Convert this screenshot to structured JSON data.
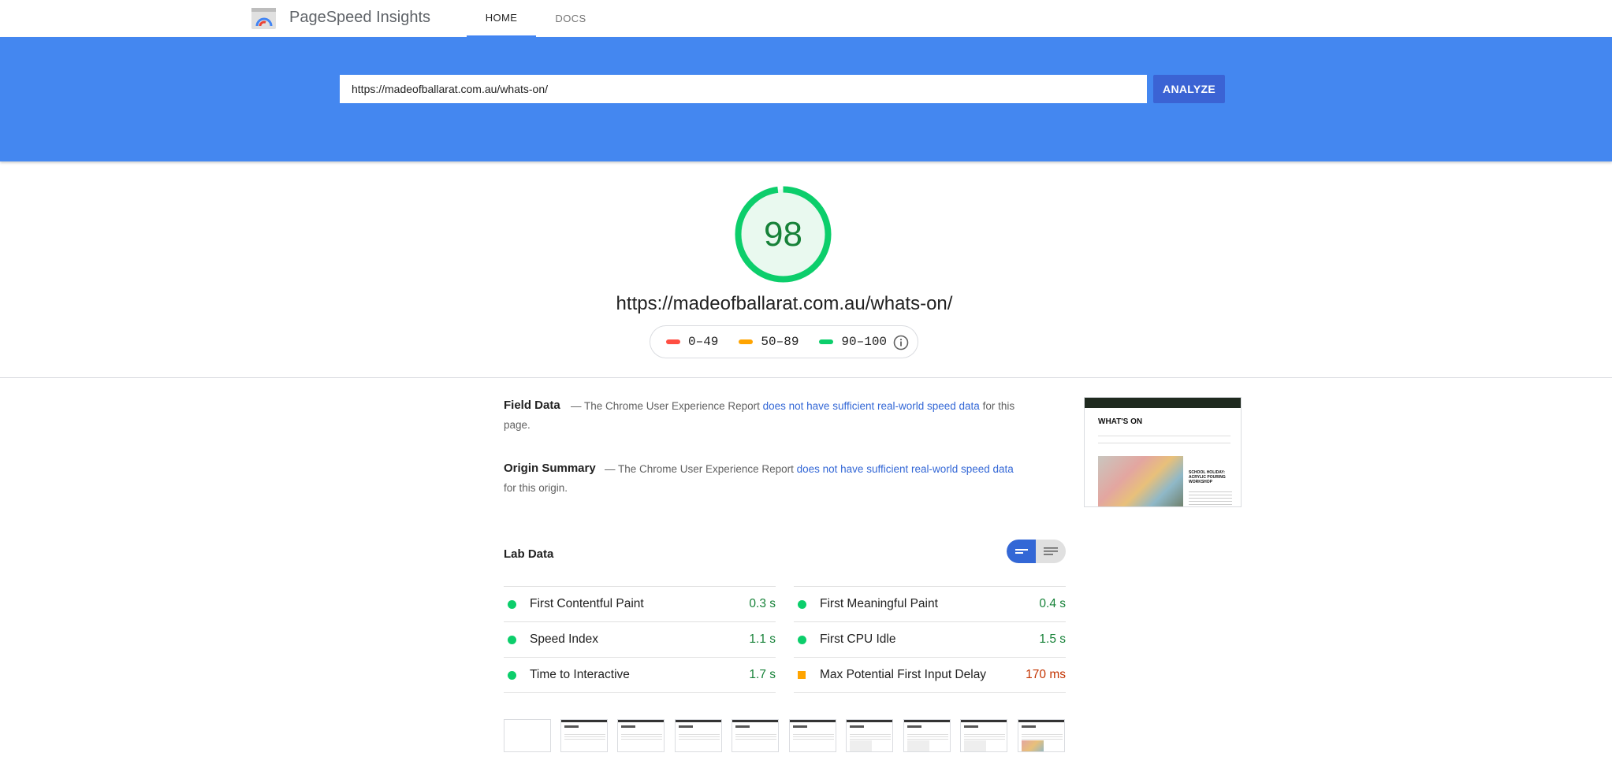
{
  "nav": {
    "brand": "PageSpeed Insights",
    "tabs": [
      {
        "label": "HOME",
        "active": true
      },
      {
        "label": "DOCS",
        "active": false
      }
    ]
  },
  "search": {
    "url_value": "https://madeofballarat.com.au/whats-on/",
    "analyze_label": "ANALYZE"
  },
  "score": {
    "value": "98",
    "fraction": 0.98,
    "color": "#0cce6b",
    "url": "https://madeofballarat.com.au/whats-on/"
  },
  "legend": [
    {
      "label": "0–49",
      "color": "#ff4e42"
    },
    {
      "label": "50–89",
      "color": "#ffa400"
    },
    {
      "label": "90–100",
      "color": "#0cce6b"
    }
  ],
  "field_data": {
    "title": "Field Data",
    "dash": "—",
    "text_before": "The Chrome User Experience Report",
    "link": "does not have sufficient real-world speed data",
    "text_after": "for this page."
  },
  "origin_summary": {
    "title": "Origin Summary",
    "dash": "—",
    "text_before": "The Chrome User Experience Report",
    "link": "does not have sufficient real-world speed data",
    "text_after": "for this origin."
  },
  "thumbnail": {
    "heading": "WHAT'S ON",
    "event_title": "SCHOOL HOLIDAY: ACRYLIC POURING WORKSHOP"
  },
  "lab_data": {
    "title": "Lab Data",
    "metrics": [
      {
        "label": "First Contentful Paint",
        "value": "0.3 s",
        "status": "pass"
      },
      {
        "label": "First Meaningful Paint",
        "value": "0.4 s",
        "status": "pass"
      },
      {
        "label": "Speed Index",
        "value": "1.1 s",
        "status": "pass"
      },
      {
        "label": "First CPU Idle",
        "value": "1.5 s",
        "status": "pass"
      },
      {
        "label": "Time to Interactive",
        "value": "1.7 s",
        "status": "pass"
      },
      {
        "label": "Max Potential First Input Delay",
        "value": "170 ms",
        "status": "average"
      }
    ]
  },
  "colors": {
    "accent_blue": "#4285f4",
    "banner": "#4487f0",
    "link": "#3367d6",
    "pass": "#0cce6b",
    "average": "#ffa400"
  }
}
